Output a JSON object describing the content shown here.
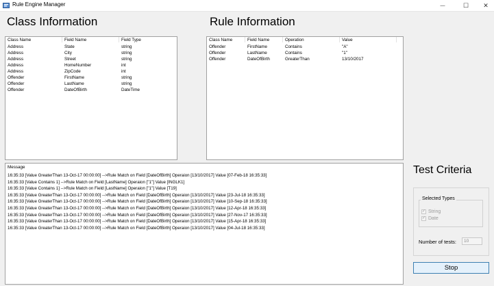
{
  "window": {
    "title": "Rule Engine Manager",
    "minimize_glyph": "—",
    "maximize_glyph": "☐",
    "close_glyph": "✕"
  },
  "class_info": {
    "title": "Class Information",
    "columns": [
      "Class Name",
      "Field Name",
      "Field Type"
    ],
    "rows": [
      [
        "Address",
        "State",
        "string"
      ],
      [
        "Address",
        "City",
        "string"
      ],
      [
        "Address",
        "Street",
        "string"
      ],
      [
        "Address",
        "HomeNumber",
        "int"
      ],
      [
        "Address",
        "ZipCode",
        "int"
      ],
      [
        "Offender",
        "FirstName",
        "string"
      ],
      [
        "Offender",
        "LastName",
        "string"
      ],
      [
        "Offender",
        "DateOfBirth",
        "DateTime"
      ]
    ]
  },
  "rule_info": {
    "title": "Rule Information",
    "columns": [
      "Class Name",
      "Field Name",
      "Operation",
      "Value"
    ],
    "rows": [
      [
        "Offender",
        "FirstName",
        "Contains",
        "\"A\""
      ],
      [
        "Offender",
        "LastName",
        "Contains",
        "\"1\""
      ],
      [
        "Offender",
        "DateOfBirth",
        "GreaterThan",
        "13/10/2017"
      ]
    ]
  },
  "messages": {
    "header": "Message",
    "lines": [
      "16:35:33 [Value GreaterThan 13-Oct-17 00:00:00] -->Rule Match on Field [DateOfBirth] Operaion [13/10/2017] Value [07-Feb-18 16:35:33]",
      "16:35:33 [Value Contains 1] -->Rule Match on Field [LastName] Operaion [\"1\"] Value [INGLK1]",
      "16:35:33 [Value Contains 1] -->Rule Match on Field [LastName] Operaion [\"1\"] Value [T19]",
      "16:35:33 [Value GreaterThan 13-Oct-17 00:00:00] -->Rule Match on Field [DateOfBirth] Operaion [13/10/2017] Value [23-Jul-18 16:35:33]",
      "16:35:33 [Value GreaterThan 13-Oct-17 00:00:00] -->Rule Match on Field [DateOfBirth] Operaion [13/10/2017] Value [10-Sep-18 16:35:33]",
      "16:35:33 [Value GreaterThan 13-Oct-17 00:00:00] -->Rule Match on Field [DateOfBirth] Operaion [13/10/2017] Value [12-Apr-18 16:35:33]",
      "16:35:33 [Value GreaterThan 13-Oct-17 00:00:00] -->Rule Match on Field [DateOfBirth] Operaion [13/10/2017] Value [27-Nov-17 16:35:33]",
      "16:35:33 [Value GreaterThan 13-Oct-17 00:00:00] -->Rule Match on Field [DateOfBirth] Operaion [13/10/2017] Value [15-Apr-18 16:35:33]",
      "16:35:33 [Value GreaterThan 13-Oct-17 00:00:00] -->Rule Match on Field [DateOfBirth] Operaion [13/10/2017] Value [04-Jul-18 16:35:33]"
    ]
  },
  "test_criteria": {
    "title": "Test Criteria",
    "group_label": "Selected Types",
    "types": [
      {
        "label": "String",
        "checked": true
      },
      {
        "label": "Date",
        "checked": true
      }
    ],
    "num_tests_label": "Number of tests:",
    "num_tests_value": "10",
    "stop_label": "Stop"
  },
  "colors": {
    "accent_border": "#3c7fb1",
    "button_fill": "#e5f1fb",
    "disabled_text": "#9a9a9a"
  }
}
